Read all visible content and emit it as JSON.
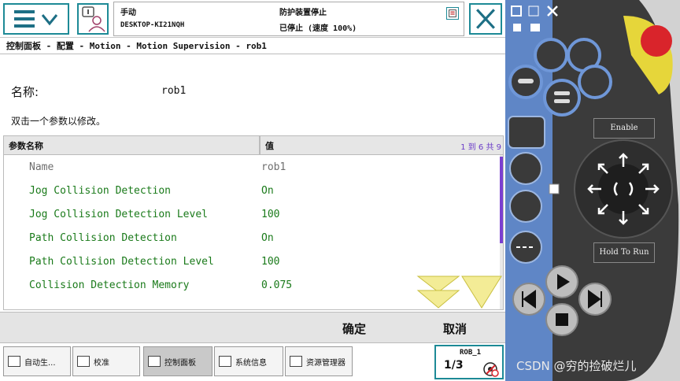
{
  "topbar": {
    "mode": "手动",
    "hostname": "DESKTOP-KI21NQH",
    "state_line1": "防护装置停止",
    "state_line2": "已停止 (速度 100%)"
  },
  "breadcrumb": "控制面板 - 配置 - Motion - Motion Supervision - rob1",
  "name_label": "名称:",
  "name_value": "rob1",
  "hint": "双击一个参数以修改。",
  "table": {
    "col_name": "参数名称",
    "col_value": "值",
    "page_info": "1 到 6 共 9",
    "rows": [
      {
        "name": "Name",
        "value": "rob1"
      },
      {
        "name": "Jog Collision Detection",
        "value": "On"
      },
      {
        "name": "Jog Collision Detection Level",
        "value": "100"
      },
      {
        "name": "Path Collision Detection",
        "value": "On"
      },
      {
        "name": "Path Collision Detection Level",
        "value": "100"
      },
      {
        "name": "Collision Detection Memory",
        "value": "0.075"
      }
    ]
  },
  "actions": {
    "ok": "确定",
    "cancel": "取消"
  },
  "taskbar": {
    "items": [
      {
        "label": "自动生..."
      },
      {
        "label": "校准"
      },
      {
        "label": "控制面板"
      },
      {
        "label": "系统信息"
      },
      {
        "label": "资源管理器"
      }
    ],
    "robot": "ROB_1",
    "fraction": "1/3"
  },
  "pendant": {
    "enable": "Enable",
    "hold_to_run": "Hold To Run"
  },
  "watermark": "CSDN @穷的捡破烂儿",
  "colors": {
    "accent": "#1d8a96",
    "editable": "#1a7a1a",
    "readonly": "#6e6e6e",
    "scroll": "#7b3fd0",
    "estop": "#d9242b"
  }
}
